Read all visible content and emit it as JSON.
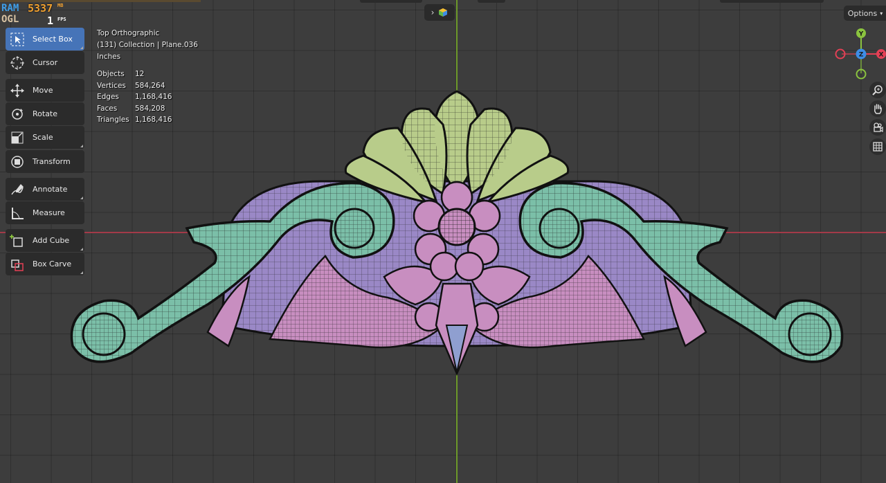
{
  "perf_overlay": {
    "ram_label": "RAM",
    "ogl_label": "OGL",
    "ram_value": "5337",
    "ram_unit": "MB",
    "fps_value": "1",
    "fps_unit": "FPS"
  },
  "header": {
    "options_label": "Options"
  },
  "toolbar": {
    "tools": [
      {
        "label": "Select Box",
        "icon": "select-box-icon",
        "active": true
      },
      {
        "label": "Cursor",
        "icon": "cursor-icon"
      },
      {
        "label": "Move",
        "icon": "move-icon"
      },
      {
        "label": "Rotate",
        "icon": "rotate-icon"
      },
      {
        "label": "Scale",
        "icon": "scale-icon"
      },
      {
        "label": "Transform",
        "icon": "transform-icon"
      },
      {
        "label": "Annotate",
        "icon": "annotate-icon"
      },
      {
        "label": "Measure",
        "icon": "measure-icon"
      },
      {
        "label": "Add Cube",
        "icon": "add-cube-icon"
      },
      {
        "label": "Box Carve",
        "icon": "box-carve-icon"
      }
    ]
  },
  "viewport_info": {
    "view_name": "Top Orthographic",
    "collection": "(131) Collection | Plane.036",
    "units": "Inches"
  },
  "stats": {
    "objects_label": "Objects",
    "objects_value": "12",
    "vertices_label": "Vertices",
    "vertices_value": "584,264",
    "edges_label": "Edges",
    "edges_value": "1,168,416",
    "faces_label": "Faces",
    "faces_value": "584,208",
    "triangles_label": "Triangles",
    "triangles_value": "1,168,416"
  },
  "gizmo": {
    "x_label": "X",
    "y_label": "Y",
    "z_label": "Z",
    "x_color": "#e44055",
    "y_color": "#8bc43f",
    "z_color": "#3d8de6"
  },
  "colors": {
    "viewport_bg": "#3d3d3d",
    "active_tool": "#4674b8",
    "teal_mesh": "#7bbfa8",
    "green_mesh": "#b8cc8a",
    "pink_mesh": "#c88ec0",
    "purple_base": "#9a88c6"
  }
}
